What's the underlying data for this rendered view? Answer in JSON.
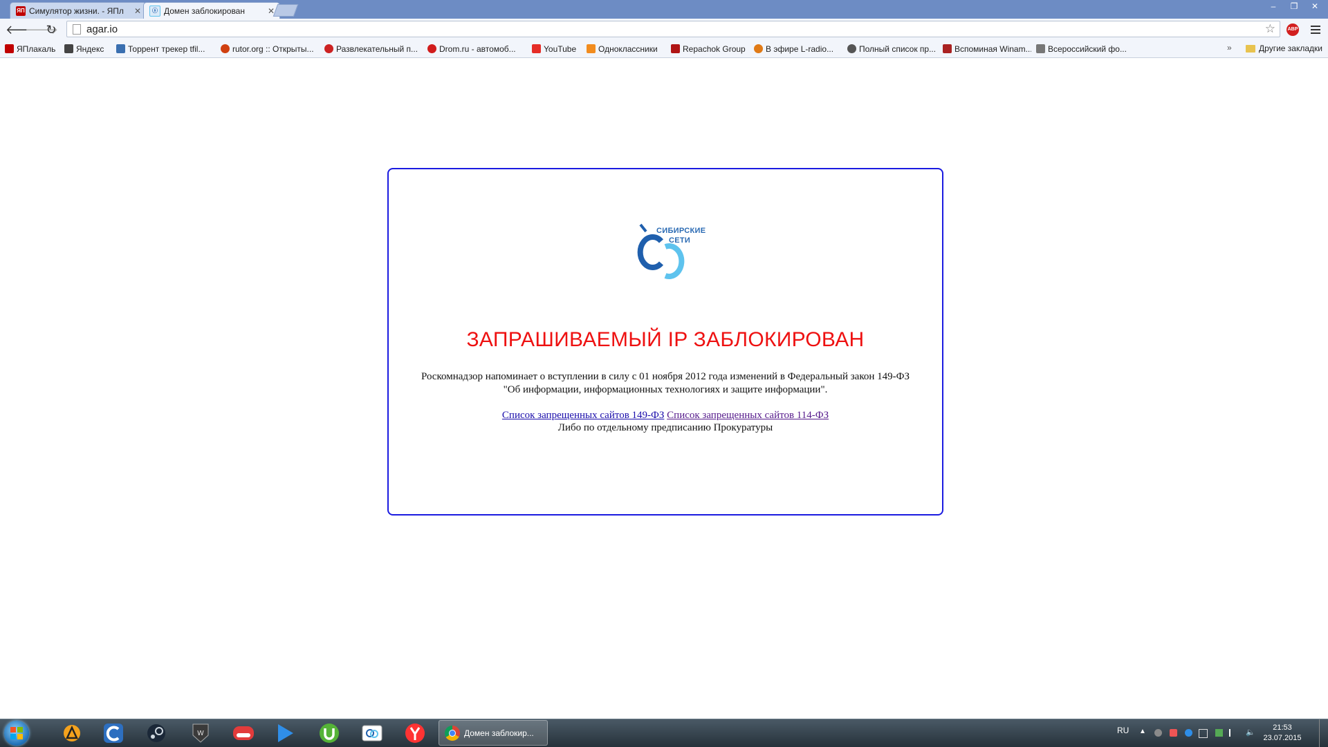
{
  "browser": {
    "tabs": [
      {
        "title": "Симулятор жизни. - ЯПл",
        "favicon": "yaplakal-icon",
        "active": false
      },
      {
        "title": "Домен заблокирован",
        "favicon": "siberian-networks-icon",
        "active": true
      }
    ],
    "address": "agar.io",
    "bookmarks": [
      {
        "label": "ЯПлакаль",
        "icon": "yaplakal-icon",
        "color": "#c00000"
      },
      {
        "label": "Яндекс",
        "icon": "yandex-icon",
        "color": "#444444"
      },
      {
        "label": "Торрент трекер tfil...",
        "icon": "tfile-icon",
        "color": "#3a6fb0"
      },
      {
        "label": "rutor.org :: Открыты...",
        "icon": "rutor-icon",
        "color": "#d04010"
      },
      {
        "label": "Развлекательный п...",
        "icon": "pikabu-icon",
        "color": "#cc2222"
      },
      {
        "label": "Drom.ru - автомоб...",
        "icon": "drom-icon",
        "color": "#d11c1c"
      },
      {
        "label": "YouTube",
        "icon": "youtube-icon",
        "color": "#e52d27"
      },
      {
        "label": "Одноклассники",
        "icon": "ok-icon",
        "color": "#f28c1e"
      },
      {
        "label": "Repachok Group",
        "icon": "repack-icon",
        "color": "#b01515"
      },
      {
        "label": "В эфире L-radio...",
        "icon": "lradio-icon",
        "color": "#e07a16"
      },
      {
        "label": "Полный список пр...",
        "icon": "tux-icon",
        "color": "#555555"
      },
      {
        "label": "Вспоминая Winam...",
        "icon": "music-note-icon",
        "color": "#aa2222"
      },
      {
        "label": "Всероссийский фо...",
        "icon": "forum-icon",
        "color": "#777777"
      }
    ],
    "other_bookmarks": "Другие закладки"
  },
  "page": {
    "logo_line1": "СИБИРСКИЕ",
    "logo_line2": "СЕТИ",
    "headline": "ЗАПРАШИВАЕМЫЙ IP ЗАБЛОКИРОВАН",
    "paragraph_line1": "Роскомнадзор напоминает о вступлении в силу с 01 ноября 2012 года изменений в Федеральный закон 149-ФЗ",
    "paragraph_line2": "\"Об информации, информационных технологиях и защите информации\".",
    "link1": "Список запрещенных сайтов 149-ФЗ",
    "link2": "Список запрещенных сайтов 114-ФЗ",
    "note": "Либо по отдельному предписанию Прокуратуры"
  },
  "taskbar": {
    "active_window": "Домен заблокир...",
    "language": "RU",
    "time": "21:53",
    "date": "23.07.2015",
    "pinned": [
      "aimp-icon",
      "cloud-icon",
      "steam-icon",
      "world-of-tanks-icon",
      "video-icon",
      "media-player-icon",
      "utorrent-icon",
      "siberian-networks-icon",
      "yandex-browser-icon"
    ]
  },
  "colors": {
    "headline": "#ee1111",
    "box_border": "#1a1ae0",
    "logo_dark": "#1f5fad",
    "logo_light": "#5ec3ee"
  }
}
